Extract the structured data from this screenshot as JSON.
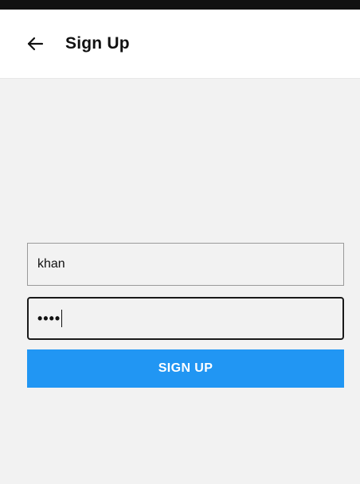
{
  "header": {
    "title": "Sign Up",
    "back_icon": "arrow-left-icon"
  },
  "form": {
    "username_value": "khan",
    "password_masked": "••••",
    "submit_label": "SIGN UP"
  },
  "colors": {
    "accent": "#2196f3",
    "background": "#f2f2f2",
    "header_background": "#ffffff",
    "status_bar": "#111111"
  }
}
